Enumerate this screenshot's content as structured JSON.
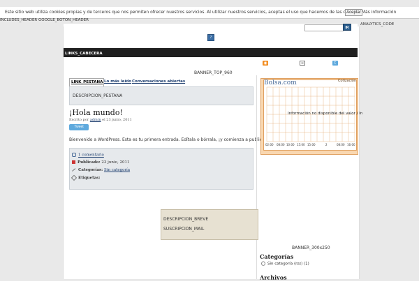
{
  "cookie": {
    "text": "Este sitio web utiliza cookies propias y de terceros que nos permiten ofrecer nuestros servicios. Al utilizar nuestros servicios, aceptas el uso que hacemos de las cookies. Más información",
    "accept_label": "Aceptar"
  },
  "top_left_text": "INCLUDES_HEADER GOOGLE_BOTON_HEADER",
  "top_right_text": "ANALYTICS_CODE",
  "header": {
    "logo_icon": "image-placeholder-icon",
    "search_placeholder": "",
    "search_button_label": "IR"
  },
  "nav": {
    "label": "LINKS_CABECERA"
  },
  "banner_top": "BANNER_TOP_960",
  "social": {
    "rss": "rss-icon",
    "mail": "mail-icon",
    "twitter": "twitter-icon"
  },
  "tabs": [
    {
      "label": "LINK_PESTANA",
      "active": true
    },
    {
      "label": "Lo más leído",
      "active": false
    },
    {
      "label": "Conversaciones abiertas",
      "active": false
    }
  ],
  "tab_description": "DESCRIPCION_PESTANA",
  "post": {
    "title": "¡Hola mundo!",
    "meta_prefix": "Escrito por",
    "author": "admin",
    "meta_date": "el 23 junio, 2011",
    "tweet_label": "Tweet",
    "body": "Bienvenido a WordPress. Esta es tu primera entrada. Edítala o bórrala, ¡y comienza a publicar!.",
    "comments_label": "1 comentario",
    "published_label": "Publicado:",
    "published_date": "23 junio, 2011",
    "category_label": "Categorías:",
    "category_value": "Sin categoría",
    "tags_label": "Etiquetas:"
  },
  "widget": {
    "title": "Cotización",
    "brand": "Bolsa.com",
    "message": "Información no disponible del valor / ín",
    "x_ticks": [
      "02:00",
      "08:00",
      "10:00",
      "15:00",
      "15:00",
      "2",
      "08:00",
      "16:00"
    ]
  },
  "brief": {
    "description": "DESCRIPCION_BREVE",
    "subscription": "SUSCRIPCION_MAIL"
  },
  "banner_side": "BANNER_300x250",
  "sidebar": {
    "categories_title": "Categorías",
    "category_item": "Sin categoría (rss) (1)",
    "archives_title": "Archivos"
  }
}
